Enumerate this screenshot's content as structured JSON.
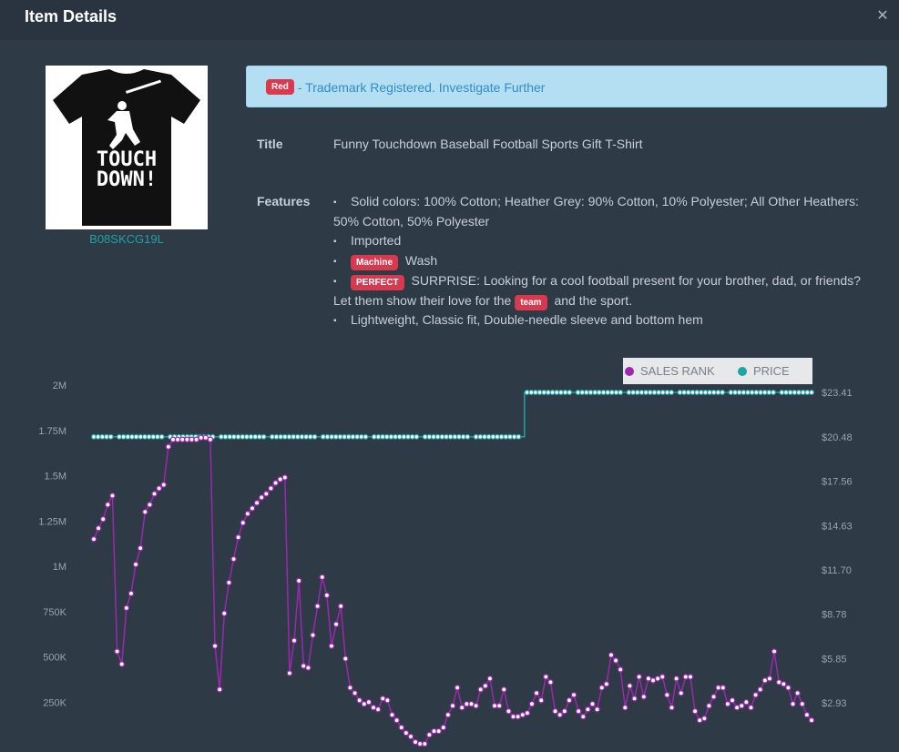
{
  "modal": {
    "title": "Item Details",
    "close_icon": "close-icon"
  },
  "product": {
    "asin": "B08SKCG19L",
    "image": {
      "text_line1": "TOUCH",
      "text_line2": "DOWN!",
      "shirt_color": "#111111",
      "graphic_color": "#ffffff"
    }
  },
  "alert": {
    "badge": "Red",
    "message": "- Trademark Registered. Investigate Further",
    "badge_color": "#d9394e"
  },
  "details": {
    "title_label": "Title",
    "title_value": "Funny Touchdown Baseball Football Sports Gift T-Shirt",
    "features_label": "Features",
    "features": [
      {
        "pre": "",
        "badge": "",
        "post": "Solid colors: 100% Cotton; Heather Grey: 90% Cotton, 10% Polyester; All Other Heathers: 50% Cotton, 50% Polyester"
      },
      {
        "pre": "",
        "badge": "",
        "post": "Imported"
      },
      {
        "pre": "",
        "badge": "Machine",
        "post": " Wash"
      },
      {
        "pre": "",
        "badge": "PERFECT",
        "post": " SURPRISE: Looking for a cool football present for your brother, dad, or friends? Let them show their love for the ",
        "badge2": "team",
        "post2": " and the sport."
      },
      {
        "pre": "",
        "badge": "",
        "post": "Lightweight, Classic fit, Double-needle sleeve and bottom hem"
      }
    ]
  },
  "legend": {
    "sales_rank": "SALES RANK",
    "price": "PRICE",
    "sales_rank_color": "#9c27b0",
    "price_color": "#1fa3a3"
  },
  "chart_data": {
    "type": "line",
    "left_axis": {
      "label": "",
      "ticks": [
        "2M",
        "1.75M",
        "1.5M",
        "1.25M",
        "1M",
        "750K",
        "500K",
        "250K"
      ],
      "tick_values": [
        2000000,
        1750000,
        1500000,
        1250000,
        1000000,
        750000,
        500000,
        250000
      ],
      "ylim": [
        0,
        2000000
      ]
    },
    "right_axis": {
      "label": "",
      "ticks": [
        "$23.41",
        "$20.48",
        "$17.56",
        "$14.63",
        "$11.70",
        "$8.78",
        "$5.85",
        "$2.93"
      ],
      "tick_values": [
        23.41,
        20.48,
        17.56,
        14.63,
        11.7,
        8.78,
        5.85,
        2.93
      ],
      "ylim": [
        0,
        23.41
      ]
    },
    "series": [
      {
        "name": "SALES RANK",
        "color": "#9c27b0",
        "values": [
          1150000,
          1210000,
          1260000,
          1340000,
          1390000,
          530000,
          460000,
          770000,
          850000,
          1010000,
          1100000,
          1300000,
          1340000,
          1400000,
          1430000,
          1450000,
          1660000,
          1700000,
          1700000,
          1700000,
          1700000,
          1700000,
          1700000,
          1710000,
          1710000,
          1700000,
          560000,
          320000,
          740000,
          910000,
          1040000,
          1160000,
          1240000,
          1290000,
          1320000,
          1350000,
          1380000,
          1400000,
          1430000,
          1460000,
          1480000,
          1490000,
          410000,
          590000,
          920000,
          450000,
          440000,
          620000,
          780000,
          940000,
          840000,
          560000,
          680000,
          780000,
          490000,
          330000,
          300000,
          260000,
          240000,
          250000,
          220000,
          210000,
          270000,
          260000,
          180000,
          150000,
          110000,
          80000,
          60000,
          30000,
          20000,
          20000,
          70000,
          90000,
          90000,
          110000,
          180000,
          230000,
          330000,
          220000,
          240000,
          240000,
          230000,
          320000,
          340000,
          380000,
          230000,
          230000,
          320000,
          200000,
          170000,
          170000,
          180000,
          190000,
          240000,
          300000,
          260000,
          390000,
          360000,
          200000,
          180000,
          200000,
          260000,
          290000,
          200000,
          170000,
          210000,
          240000,
          210000,
          330000,
          350000,
          510000,
          480000,
          430000,
          220000,
          340000,
          270000,
          390000,
          280000,
          380000,
          370000,
          380000,
          390000,
          290000,
          220000,
          380000,
          300000,
          390000,
          390000,
          200000,
          150000,
          160000,
          230000,
          280000,
          330000,
          330000,
          240000,
          260000,
          220000,
          230000,
          250000,
          220000,
          290000,
          320000,
          370000,
          380000,
          530000,
          360000,
          350000,
          330000,
          240000,
          300000,
          240000,
          180000,
          150000
        ]
      },
      {
        "name": "PRICE",
        "color": "#1fa3a3",
        "values": [
          20.48,
          20.48,
          23.41
        ],
        "steps": [
          {
            "from": 0,
            "to": 0.6,
            "value": 20.48
          },
          {
            "from": 0.6,
            "to": 1.0,
            "value": 23.41
          }
        ]
      }
    ],
    "legend_position": "top-right",
    "grid": false
  }
}
